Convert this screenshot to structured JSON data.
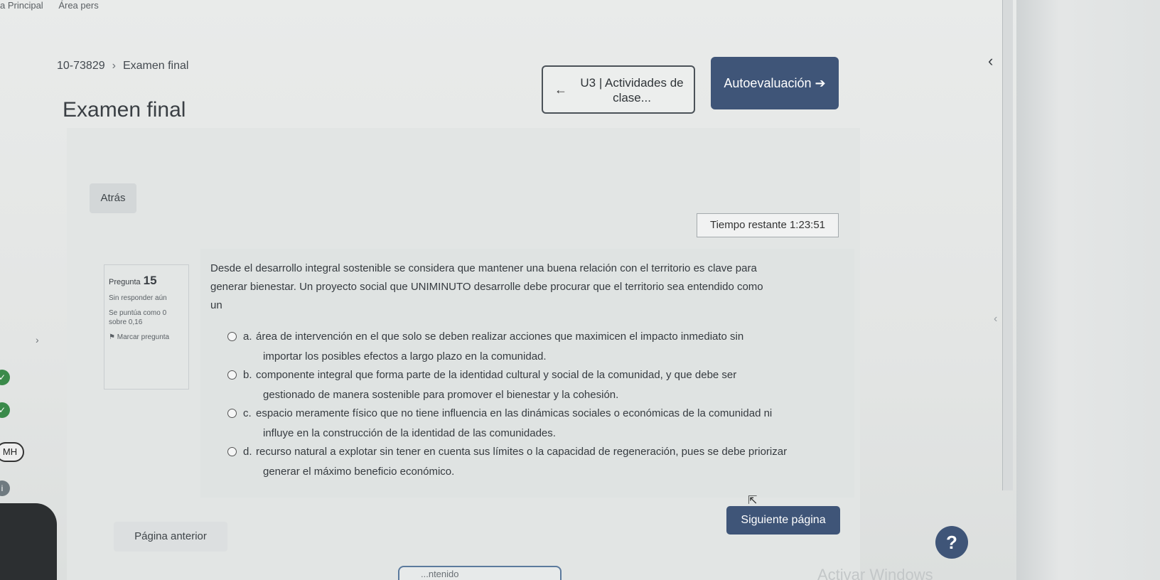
{
  "topnav": {
    "items": [
      "a Principal",
      "Área pers"
    ]
  },
  "breadcrumb": {
    "course": "10-73829",
    "separator": "›",
    "current": "Examen final"
  },
  "page": {
    "title": "Examen final"
  },
  "activity_nav": {
    "prev_label": "U3 | Actividades de clase...",
    "next_label": "Autoevaluación ➔"
  },
  "quiz": {
    "back_label": "Atrás",
    "timer_label": "Tiempo restante",
    "timer_value": "1:23:51",
    "question": {
      "label": "Pregunta",
      "number": "15",
      "status": "Sin responder aún",
      "score": "Se puntúa como 0 sobre 0,16",
      "flag_label": "Marcar pregunta",
      "text_l1": "Desde el desarrollo integral sostenible se considera que mantener una buena relación con el territorio es clave para",
      "text_l2": "generar bienestar. Un proyecto social que UNIMINUTO desarrolle debe procurar que el territorio sea entendido como",
      "text_l3": "un",
      "options": [
        {
          "letter": "a.",
          "l1": "área de intervención en el que solo se deben realizar acciones que maximicen el impacto inmediato sin",
          "l2": "importar los posibles efectos a largo plazo en la comunidad."
        },
        {
          "letter": "b.",
          "l1": "componente integral que forma parte de la identidad cultural y social de la comunidad, y que debe ser",
          "l2": "gestionado de manera sostenible para promover el bienestar y la cohesión."
        },
        {
          "letter": "c.",
          "l1": "espacio meramente físico que no tiene influencia en las dinámicas sociales o económicas de la comunidad ni",
          "l2": "influye en la construcción de la identidad de las comunidades."
        },
        {
          "letter": "d.",
          "l1": "recurso natural a explotar sin tener en cuenta sus límites o la capacidad de regeneración, pues se debe priorizar",
          "l2": "generar el máximo beneficio económico."
        }
      ]
    },
    "prev_page_label": "Página anterior",
    "next_page_label": "Siguiente página"
  },
  "help": {
    "label": "?"
  },
  "sidebar": {
    "avatar_initials": "MH"
  },
  "bottom_tab": {
    "label": "...ntenido"
  },
  "watermark": "Activar Windows",
  "colors": {
    "primary": "#3f5578",
    "background": "#e6e8e7"
  }
}
